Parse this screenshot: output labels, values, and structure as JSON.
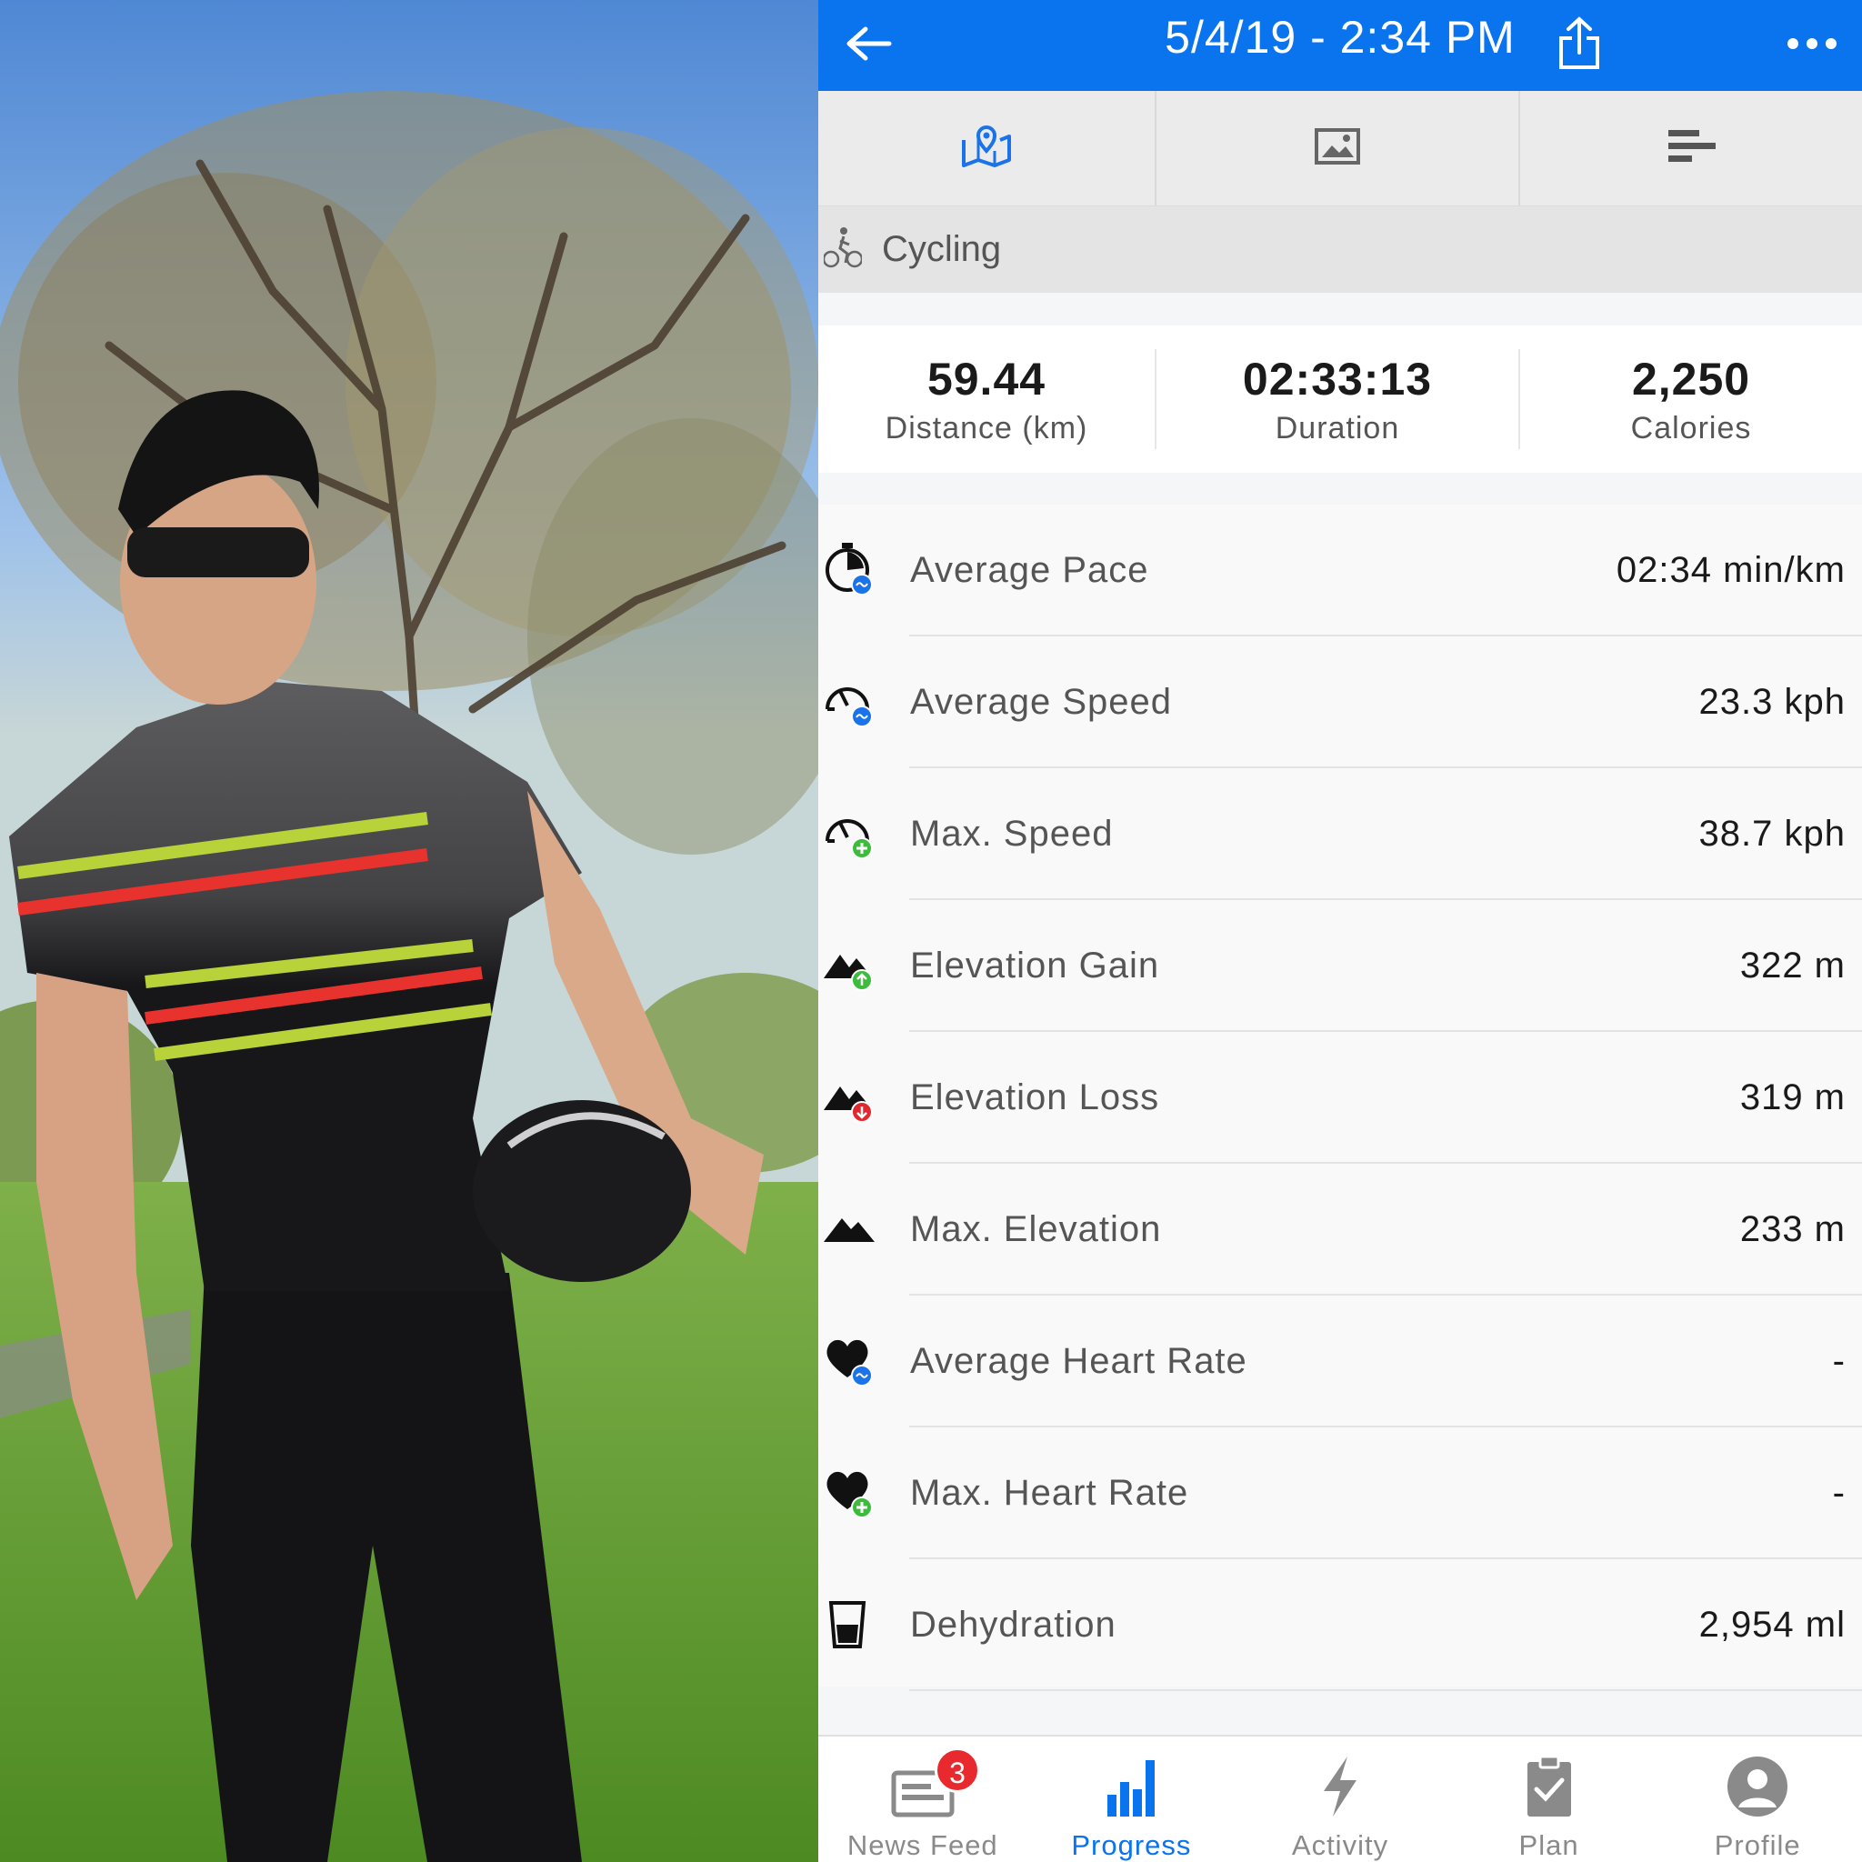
{
  "header": {
    "title": "5/4/19 - 2:34 PM",
    "back_icon": "arrow-left-icon",
    "share_icon": "share-icon",
    "more_icon": "more-dots-icon",
    "bar_color": "#0a74ee"
  },
  "tabs": [
    {
      "icon": "map-pin-icon",
      "selected": true
    },
    {
      "icon": "image-icon",
      "selected": false
    },
    {
      "icon": "bars-icon",
      "selected": false
    }
  ],
  "activity_type": {
    "icon": "cycling-icon",
    "label": "Cycling"
  },
  "summary": [
    {
      "value": "59.44",
      "label": "Distance (km)"
    },
    {
      "value": "02:33:13",
      "label": "Duration"
    },
    {
      "value": "2,250",
      "label": "Calories"
    }
  ],
  "metrics": [
    {
      "name": "Average Pace",
      "value": "02:34 min/km",
      "icon": "stopwatch-avg-icon"
    },
    {
      "name": "Average Speed",
      "value": "23.3 kph",
      "icon": "speedometer-avg-icon"
    },
    {
      "name": "Max. Speed",
      "value": "38.7 kph",
      "icon": "speedometer-max-icon"
    },
    {
      "name": "Elevation Gain",
      "value": "322 m",
      "icon": "mountain-up-icon"
    },
    {
      "name": "Elevation Loss",
      "value": "319 m",
      "icon": "mountain-down-icon"
    },
    {
      "name": "Max. Elevation",
      "value": "233 m",
      "icon": "mountain-icon"
    },
    {
      "name": "Average Heart Rate",
      "value": "-",
      "icon": "heart-avg-icon"
    },
    {
      "name": "Max. Heart Rate",
      "value": "-",
      "icon": "heart-max-icon"
    },
    {
      "name": "Dehydration",
      "value": "2,954 ml",
      "icon": "cup-icon"
    }
  ],
  "bottom_nav": [
    {
      "label": "News Feed",
      "icon": "news-feed-icon",
      "badge": "3",
      "active": false
    },
    {
      "label": "Progress",
      "icon": "progress-chart-icon",
      "active": true
    },
    {
      "label": "Activity",
      "icon": "lightning-icon",
      "active": false
    },
    {
      "label": "Plan",
      "icon": "clipboard-check-icon",
      "active": false
    },
    {
      "label": "Profile",
      "icon": "profile-icon",
      "active": false
    }
  ],
  "colors": {
    "accent": "#0a74ee",
    "badge": "#e8292e",
    "avg_indicator": "#1a73e8",
    "max_indicator": "#3dbb3d",
    "loss_indicator": "#e0282e"
  }
}
